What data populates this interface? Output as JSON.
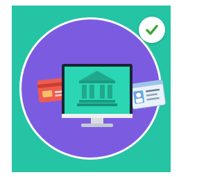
{
  "icons": {
    "badge": "check-icon",
    "main": "online-banking-computer-icon",
    "left_card": "credit-card-icon",
    "right_card": "id-card-icon"
  },
  "colors": {
    "background": "#24c4a4",
    "disc": "#7b5ce1",
    "monitor": "#2ad6b3",
    "bank": "#1fa88c",
    "check": "#3aa935",
    "credit_card": "#ef5b4f",
    "id_card": "#e8f2fb"
  }
}
